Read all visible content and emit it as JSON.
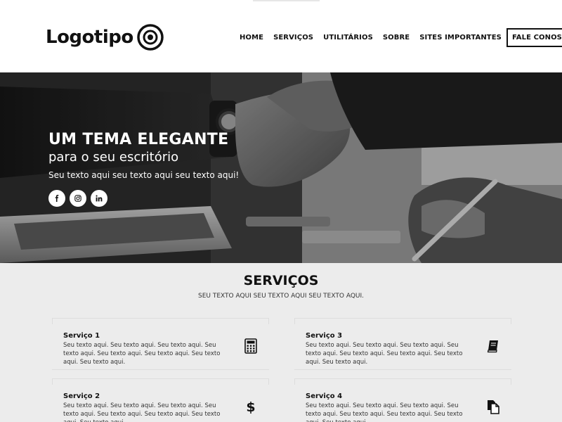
{
  "header": {
    "logo_text": "Logotipo",
    "logo_icon": "target-icon",
    "nav": [
      {
        "label": "HOME"
      },
      {
        "label": "SERVIÇOS"
      },
      {
        "label": "UTILITÁRIOS"
      },
      {
        "label": "SOBRE"
      },
      {
        "label": "SITES IMPORTANTES"
      }
    ],
    "cta_label": "FALE CONOSCO"
  },
  "hero": {
    "title": "UM TEMA ELEGANTE",
    "subtitle": "para o seu escritório",
    "text": "Seu texto aqui seu texto aqui seu texto aqui!",
    "image": "handshake-photo",
    "socials": [
      {
        "icon": "facebook-icon"
      },
      {
        "icon": "instagram-icon"
      },
      {
        "icon": "linkedin-icon"
      }
    ]
  },
  "services": {
    "heading": "SERVIÇOS",
    "subheading": "SEU TEXTO AQUI SEU TEXTO AQUI SEU TEXTO AQUI.",
    "cards": [
      {
        "title": "Serviço 1",
        "text": "Seu texto aqui. Seu texto aqui. Seu texto aqui. Seu texto aqui. Seu texto aqui. Seu texto aqui. Seu texto aqui. Seu texto aqui.",
        "icon": "calculator-icon"
      },
      {
        "title": "Serviço 3",
        "text": "Seu texto aqui. Seu texto aqui. Seu texto aqui. Seu texto aqui. Seu texto aqui. Seu texto aqui. Seu texto aqui. Seu texto aqui.",
        "icon": "book-icon"
      },
      {
        "title": "Serviço 2",
        "text": "Seu texto aqui. Seu texto aqui. Seu texto aqui. Seu texto aqui. Seu texto aqui. Seu texto aqui. Seu texto aqui. Seu texto aqui.",
        "icon": "dollar-icon"
      },
      {
        "title": "Serviço 4",
        "text": "Seu texto aqui. Seu texto aqui. Seu texto aqui. Seu texto aqui. Seu texto aqui. Seu texto aqui. Seu texto aqui. Seu texto aqui.",
        "icon": "documents-icon"
      }
    ]
  },
  "colors": {
    "text": "#111111",
    "section_bg": "#ececec",
    "hero_text": "#ffffff"
  }
}
